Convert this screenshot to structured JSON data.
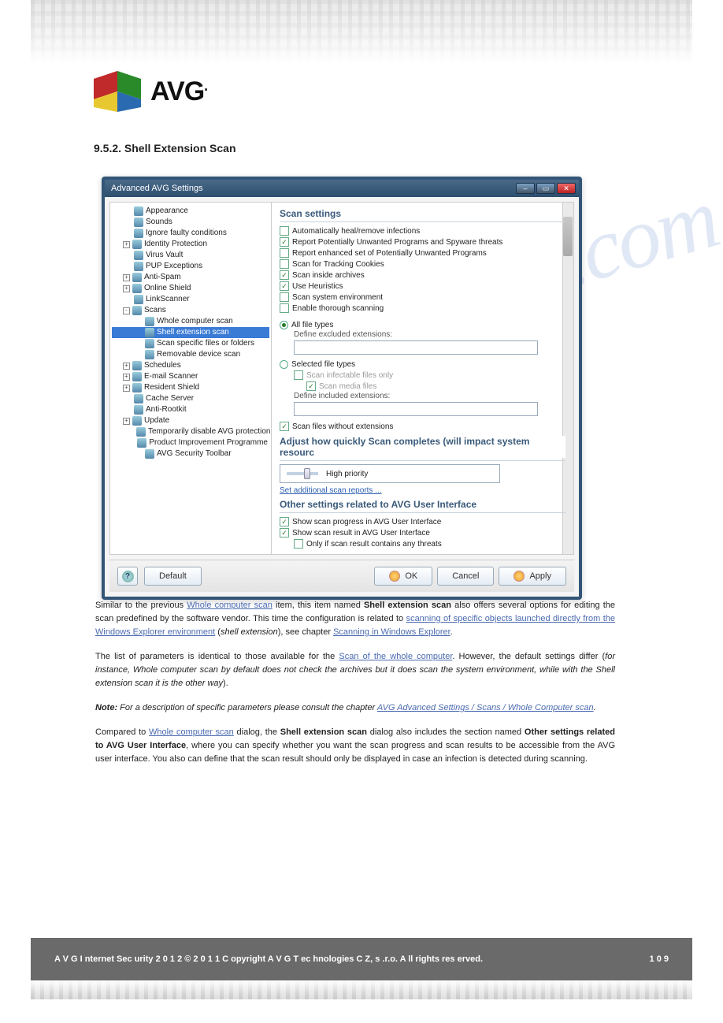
{
  "logo_text": "AVG",
  "section_heading": "9.5.2. Shell Extension Scan",
  "dialog": {
    "title": "Advanced AVG Settings",
    "tree": [
      {
        "level": 1,
        "exp": "",
        "icon": true,
        "label": "Appearance"
      },
      {
        "level": 1,
        "exp": "",
        "icon": true,
        "label": "Sounds"
      },
      {
        "level": 1,
        "exp": "",
        "icon": true,
        "label": "Ignore faulty conditions"
      },
      {
        "level": 1,
        "exp": "+",
        "icon": true,
        "label": "Identity Protection"
      },
      {
        "level": 1,
        "exp": "",
        "icon": true,
        "label": "Virus Vault"
      },
      {
        "level": 1,
        "exp": "",
        "icon": true,
        "label": "PUP Exceptions"
      },
      {
        "level": 1,
        "exp": "+",
        "icon": true,
        "label": "Anti-Spam"
      },
      {
        "level": 1,
        "exp": "+",
        "icon": true,
        "label": "Online Shield"
      },
      {
        "level": 1,
        "exp": "",
        "icon": true,
        "label": "LinkScanner"
      },
      {
        "level": 1,
        "exp": "-",
        "icon": true,
        "label": "Scans"
      },
      {
        "level": 2,
        "exp": "",
        "icon": true,
        "label": "Whole computer scan"
      },
      {
        "level": 2,
        "exp": "",
        "icon": true,
        "label": "Shell extension scan",
        "selected": true
      },
      {
        "level": 2,
        "exp": "",
        "icon": true,
        "label": "Scan specific files or folders"
      },
      {
        "level": 2,
        "exp": "",
        "icon": true,
        "label": "Removable device scan"
      },
      {
        "level": 1,
        "exp": "+",
        "icon": true,
        "label": "Schedules"
      },
      {
        "level": 1,
        "exp": "+",
        "icon": true,
        "label": "E-mail Scanner"
      },
      {
        "level": 1,
        "exp": "+",
        "icon": true,
        "label": "Resident Shield"
      },
      {
        "level": 1,
        "exp": "",
        "icon": true,
        "label": "Cache Server"
      },
      {
        "level": 1,
        "exp": "",
        "icon": true,
        "label": "Anti-Rootkit"
      },
      {
        "level": 1,
        "exp": "+",
        "icon": true,
        "label": "Update"
      },
      {
        "level": 2,
        "exp": "",
        "icon": true,
        "label": "Temporarily disable AVG protection"
      },
      {
        "level": 2,
        "exp": "",
        "icon": true,
        "label": "Product Improvement Programme"
      },
      {
        "level": 2,
        "exp": "",
        "icon": true,
        "label": "AVG Security Toolbar"
      }
    ],
    "scan_settings_heading": "Scan settings",
    "checks": [
      {
        "checked": false,
        "label": "Automatically heal/remove infections"
      },
      {
        "checked": true,
        "label": "Report Potentially Unwanted Programs and Spyware threats"
      },
      {
        "checked": false,
        "label": "Report enhanced set of Potentially Unwanted Programs"
      },
      {
        "checked": false,
        "label": "Scan for Tracking Cookies"
      },
      {
        "checked": true,
        "label": "Scan inside archives"
      },
      {
        "checked": true,
        "label": "Use Heuristics"
      },
      {
        "checked": false,
        "label": "Scan system environment"
      },
      {
        "checked": false,
        "label": "Enable thorough scanning"
      }
    ],
    "radio_all_label": "All file types",
    "excluded_label": "Define excluded extensions:",
    "radio_selected_label": "Selected file types",
    "scan_infectable_label": "Scan infectable files only",
    "scan_media_label": "Scan media files",
    "included_label": "Define included extensions:",
    "no_ext_label": "Scan files without extensions",
    "adjust_heading": "Adjust how quickly Scan completes (will impact system resourc",
    "priority_label": "High priority",
    "additional_reports_link": "Set additional scan reports ...",
    "other_heading": "Other settings related to AVG User Interface",
    "other_checks": [
      {
        "checked": true,
        "indent": 0,
        "label": "Show scan progress in AVG User Interface"
      },
      {
        "checked": true,
        "indent": 0,
        "label": "Show scan result in AVG User Interface"
      },
      {
        "checked": false,
        "indent": 1,
        "label": "Only if scan result contains any threats"
      }
    ],
    "buttons": {
      "default": "Default",
      "ok": "OK",
      "cancel": "Cancel",
      "apply": "Apply"
    }
  },
  "body": {
    "p1_a": "Similar to the previous ",
    "p1_link1": "Whole computer scan",
    "p1_b": " item, this item named ",
    "p1_strong": "Shell extension scan",
    "p1_c": " also offers several options for editing the scan predefined by the software vendor. This time the configuration is related to ",
    "p1_link2": "scanning of specific objects launched directly from the Windows Explorer environment",
    "p1_d": " (",
    "p1_italic": "shell extension",
    "p1_e": "), see chapter ",
    "p1_link3": "Scanning in Windows Explorer",
    "p1_f": ".",
    "p2_a": "The list of parameters is identical to those available for the ",
    "p2_link": "Scan of the whole computer",
    "p2_b": ". However, the default settings differ (",
    "p2_italic": "for instance, Whole computer scan by default does not check the archives but it does scan the system environment, while with the Shell extension scan it is the other way",
    "p2_c": ").",
    "note_strong": "Note:",
    "note_italic": " For a description of specific parameters please consult the chapter ",
    "note_link": "AVG Advanced Settings / Scans / Whole Computer scan",
    "note_end": ".",
    "p3_a": "Compared to ",
    "p3_link1": "Whole computer scan",
    "p3_b": " dialog, the ",
    "p3_strong": "Shell extension scan",
    "p3_c": " dialog also includes the section named ",
    "p3_strong2": "Other settings related to AVG User Interface",
    "p3_d": ", where you can specify whether you want the scan progress and scan results to be accessible from the AVG user interface. You also can define that the scan result should only be displayed in case an infection is detected during scanning."
  },
  "footer": {
    "left": "A V G I nternet Sec urity 2 0 1 2 © 2 0 1 1 C opyright A V G T ec hnologies C Z, s .r.o. A ll rights res erved.",
    "right": "1 0 9"
  },
  "watermark": "manualzhive.com"
}
